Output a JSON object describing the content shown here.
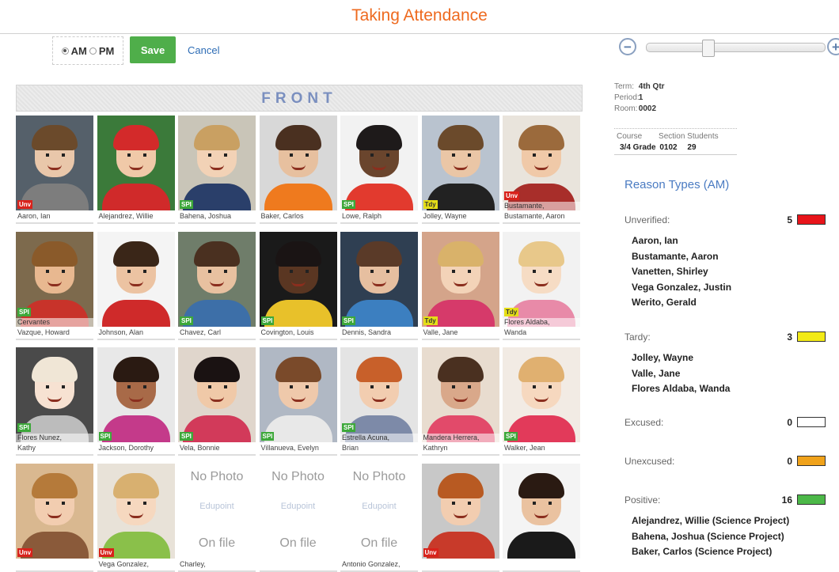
{
  "header": {
    "title": "Taking Attendance"
  },
  "toolbar": {
    "am_label": "AM",
    "pm_label": "PM",
    "selected_session": "AM",
    "save_label": "Save",
    "cancel_label": "Cancel"
  },
  "zoom": {
    "minus_icon": "zoom-out-icon",
    "plus_icon": "zoom-in-icon",
    "level": 0.33
  },
  "front_label": "FRONT",
  "students": [
    {
      "caption": "Aaron, Ian",
      "badge": "Unv",
      "hair": "#6b4a2b",
      "skin": "#e9c7aa",
      "shirt": "#7d7d7d",
      "bg": "#55606a"
    },
    {
      "caption": "Alejandrez, Willie",
      "badge": "",
      "hair": "#d32a2a",
      "skin": "#f0c9a8",
      "shirt": "#d02a2a",
      "bg": "#3b7a3a"
    },
    {
      "caption": "Bahena, Joshua",
      "badge": "SPI",
      "hair": "#c9a062",
      "skin": "#f2d2b6",
      "shirt": "#2a3f6a",
      "bg": "#c9c5b8"
    },
    {
      "caption": "Baker, Carlos",
      "badge": "",
      "hair": "#4a3020",
      "skin": "#e7c09f",
      "shirt": "#ef7a1e",
      "bg": "#d8d8d8"
    },
    {
      "caption": "Lowe, Ralph",
      "badge": "SPI",
      "hair": "#1e1a1a",
      "skin": "#6a452d",
      "shirt": "#e23a2e",
      "bg": "#f2f2f2"
    },
    {
      "caption": "Jolley, Wayne",
      "badge": "Tdy",
      "hair": "#6b4a2b",
      "skin": "#eac6a6",
      "shirt": "#222222",
      "bg": "#b9c3cf"
    },
    {
      "caption": "Bustamante, Aaron",
      "overlay": "Bustamante,",
      "caption_short": "Aaron",
      "badge": "Unv",
      "hair": "#9b6a3c",
      "skin": "#f0c9a8",
      "shirt": "#a82e2a",
      "bg": "#e9e4dc"
    },
    {
      "caption": "Vazque, Howard",
      "overlay": "Cervantes",
      "badge": "SPI",
      "hair": "#8a5a2a",
      "skin": "#e8b890",
      "shirt": "#c8332a",
      "bg": "#7d6a4d"
    },
    {
      "caption": "Johnson, Alan",
      "badge": "",
      "hair": "#3a2618",
      "skin": "#ecc3a2",
      "shirt": "#cf2a2a",
      "bg": "#f4f4f4"
    },
    {
      "caption": "Chavez, Carl",
      "badge": "SPI",
      "hair": "#4a3020",
      "skin": "#e8c1a0",
      "shirt": "#3d6fa8",
      "bg": "#6f7d6a"
    },
    {
      "caption": "Covington, Louis",
      "badge": "SPI",
      "hair": "#1a1414",
      "skin": "#5a3622",
      "shirt": "#e8c12a",
      "bg": "#1a1a1a"
    },
    {
      "caption": "Dennis, Sandra",
      "badge": "SPI",
      "hair": "#5a3a28",
      "skin": "#e6bfa0",
      "shirt": "#3c7fc0",
      "bg": "#2f3f52"
    },
    {
      "caption": "Valle, Jane",
      "badge": "Tdy",
      "hair": "#d9b26a",
      "skin": "#f3d3b8",
      "shirt": "#d63a6a",
      "bg": "#d4a48a"
    },
    {
      "caption": "Wanda",
      "overlay": "Flores Aldaba,",
      "badge": "Tdy",
      "hair": "#e8c88a",
      "skin": "#f6dcc4",
      "shirt": "#e88aa8",
      "bg": "#f2f2f2"
    },
    {
      "caption": "Kathy",
      "overlay": "Flores Nunez,",
      "badge": "SPI",
      "hair": "#f0e6d6",
      "skin": "#f7e2d2",
      "shirt": "#bcbcbc",
      "bg": "#4a4a4a"
    },
    {
      "caption": "Jackson, Dorothy",
      "badge": "SPI",
      "hair": "#2a1a12",
      "skin": "#a86a48",
      "shirt": "#c43a8a",
      "bg": "#e8e8e8"
    },
    {
      "caption": "Vela, Bonnie",
      "badge": "SPI",
      "hair": "#1a1212",
      "skin": "#f0c9a8",
      "shirt": "#d23a5a",
      "bg": "#e0d6cc"
    },
    {
      "caption": "Villanueva, Evelyn",
      "badge": "SPI",
      "hair": "#7a4a2a",
      "skin": "#efc9ab",
      "shirt": "#e8e8e8",
      "bg": "#b0b8c4"
    },
    {
      "caption": "Brian",
      "overlay": "Estrella Acuna,",
      "badge": "SPI",
      "hair": "#c8602a",
      "skin": "#f2cdb0",
      "shirt": "#7d8aa8",
      "bg": "#e4e4e4"
    },
    {
      "caption": "Kathryn",
      "overlay": "Mandera Herrera,",
      "badge": "",
      "hair": "#4a3020",
      "skin": "#d9a88a",
      "shirt": "#e24a6a",
      "bg": "#e8dccf"
    },
    {
      "caption": "Walker, Jean",
      "badge": "SPI",
      "hair": "#e0b070",
      "skin": "#f6d8bf",
      "shirt": "#e23a5a",
      "bg": "#f2ebe4"
    },
    {
      "caption": "",
      "badge": "Unv",
      "hair": "#b57a3a",
      "skin": "#f2cdb0",
      "shirt": "#8a5a3a",
      "bg": "#d9b890"
    },
    {
      "caption": "Vega Gonzalez,",
      "badge": "Unv",
      "hair": "#d8b070",
      "skin": "#f6d8bf",
      "shirt": "#8ac04a",
      "bg": "#e8e2d8"
    },
    {
      "nophoto": true,
      "caption": "Charley,",
      "line1": "No Photo",
      "logo": "Edupoint",
      "line2": "On file"
    },
    {
      "nophoto": true,
      "caption": "",
      "line1": "No Photo",
      "logo": "Edupoint",
      "line2": "On file"
    },
    {
      "nophoto": true,
      "caption": "Antonio Gonzalez,",
      "line1": "No Photo",
      "logo": "Edupoint",
      "line2": "On file"
    },
    {
      "caption": "",
      "badge": "Unv",
      "hair": "#b85a22",
      "skin": "#f2cdb0",
      "shirt": "#c83a2a",
      "bg": "#c8c8c8"
    },
    {
      "caption": "",
      "badge": "",
      "hair": "#2a1a12",
      "skin": "#eac2a0",
      "shirt": "#1a1a1a",
      "bg": "#f4f4f4"
    }
  ],
  "info": {
    "term_label": "Term:",
    "term": "4th Qtr",
    "period_label": "Period:",
    "period": "1",
    "room_label": "Room:",
    "room": "0002",
    "course_header": "Course",
    "section_header": "Section",
    "students_header": "Students",
    "course": "3/4 Grade",
    "section": "0102",
    "students": "29"
  },
  "reasons_title": "Reason Types (AM)",
  "reasons": [
    {
      "label": "Unverified:",
      "count": "5",
      "color": "#e8141a",
      "names": [
        "Aaron, Ian",
        "Bustamante, Aaron",
        "Vanetten, Shirley",
        "Vega Gonzalez, Justin",
        "Werito, Gerald"
      ]
    },
    {
      "label": "Tardy:",
      "count": "3",
      "color": "#f2ea17",
      "names": [
        "Jolley, Wayne",
        "Valle, Jane",
        "Flores Aldaba, Wanda"
      ]
    },
    {
      "label": "Excused:",
      "count": "0",
      "color": "#ffffff",
      "names": []
    },
    {
      "label": "Unexcused:",
      "count": "0",
      "color": "#f0a21a",
      "names": []
    },
    {
      "label": "Positive:",
      "count": "16",
      "color": "#4cb848",
      "names": [
        "Alejandrez, Willie (Science Project)",
        "Bahena, Joshua (Science Project)",
        "Baker, Carlos (Science Project)"
      ]
    }
  ]
}
